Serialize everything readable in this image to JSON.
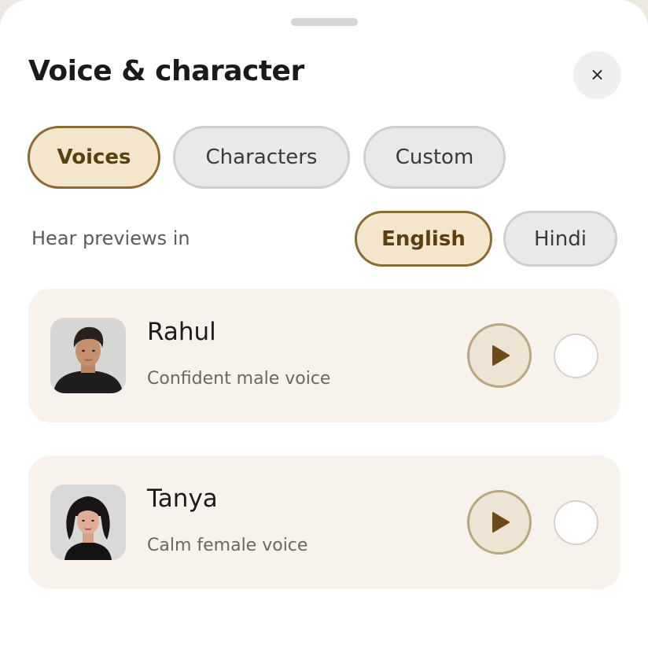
{
  "header": {
    "title": "Voice & character",
    "close_icon": "close-icon",
    "close_glyph": "×"
  },
  "tabs": [
    {
      "label": "Voices",
      "active": true
    },
    {
      "label": "Characters",
      "active": false
    },
    {
      "label": "Custom",
      "active": false
    }
  ],
  "previews": {
    "label": "Hear previews in",
    "languages": [
      {
        "label": "English",
        "active": true
      },
      {
        "label": "Hindi",
        "active": false
      }
    ]
  },
  "voices": [
    {
      "name": "Rahul",
      "description": "Confident male voice",
      "selected": false,
      "avatar_icon": "male-avatar-photo",
      "play_icon": "play-icon"
    },
    {
      "name": "Tanya",
      "description": "Calm female voice",
      "selected": false,
      "avatar_icon": "female-avatar-photo",
      "play_icon": "play-icon"
    }
  ],
  "colors": {
    "accent_fill": "#f3e6cd",
    "accent_border": "#8a6a35",
    "accent_text": "#5a3f10",
    "card_bg": "#f7f2eb",
    "play_icon": "#6b4c18"
  }
}
